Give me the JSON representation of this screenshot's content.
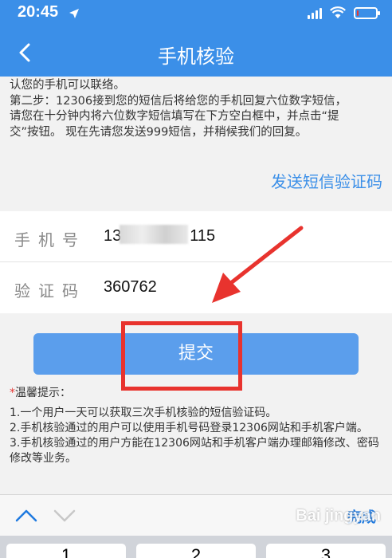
{
  "status": {
    "time": "20:45",
    "battery_level": 0.1,
    "battery_color": "#e53935"
  },
  "nav": {
    "title": "手机核验",
    "back_icon": "chevron-left-icon"
  },
  "info": {
    "line1": "认您的手机可以联络。",
    "line2": "第二步：12306接到您的短信后将给您的手机回复六位数字短信，",
    "line3": "请您在十分钟内将六位数字短信填写在下方空白框中，并点击“提",
    "line4": "交”按钮。 现在先请您发送999短信，并稍候我们的回复。"
  },
  "send_code_link": "发送短信验证码",
  "form": {
    "phone_label": "手机号",
    "phone_value_start": "13",
    "phone_value_end": "115",
    "code_label": "验证码",
    "code_value": "360762"
  },
  "submit_label": "提交",
  "tips": {
    "star": "*",
    "title": "温馨提示：",
    "items": [
      "1.一个用户一天可以获取三次手机核验的短信验证码。",
      "2.手机核验通过的用户可以使用手机号码登录12306网站和手机客户端。",
      "3.手机核验通过的用户方能在12306网站和手机客户端办理邮箱修改、密码修改等业务。"
    ]
  },
  "keyboard": {
    "done_label": "完成",
    "keys": [
      "1",
      "2",
      "3"
    ]
  },
  "watermark": "Bai jingyan",
  "colors": {
    "accent": "#3b8fe8",
    "highlight": "#e8332e"
  }
}
